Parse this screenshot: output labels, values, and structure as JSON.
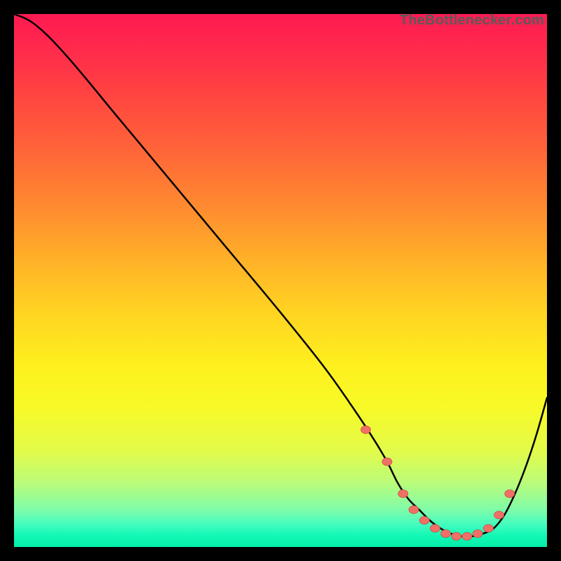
{
  "brand": "TheBottlenecker.com",
  "colors": {
    "curve": "#000000",
    "marker_fill": "#f07066",
    "marker_stroke": "#c95048"
  },
  "chart_data": {
    "type": "line",
    "title": "",
    "xlabel": "",
    "ylabel": "",
    "xlim": [
      0,
      100
    ],
    "ylim": [
      0,
      100
    ],
    "x": [
      0,
      4,
      10,
      20,
      30,
      40,
      50,
      58,
      63,
      67,
      70,
      72,
      74,
      76,
      78,
      80,
      82,
      84,
      86,
      88,
      90,
      92,
      94,
      96,
      98,
      100
    ],
    "values": [
      100,
      98,
      92,
      80,
      68,
      56,
      44,
      34,
      27,
      21,
      16,
      12,
      9,
      7,
      5,
      3.5,
      2.5,
      2,
      2,
      2.5,
      3.5,
      6,
      10,
      15,
      21,
      28
    ],
    "markers": {
      "x": [
        66,
        70,
        73,
        75,
        77,
        79,
        81,
        83,
        85,
        87,
        89,
        91,
        93
      ],
      "values": [
        22,
        16,
        10,
        7,
        5,
        3.5,
        2.5,
        2,
        2,
        2.5,
        3.5,
        6,
        10
      ]
    }
  }
}
